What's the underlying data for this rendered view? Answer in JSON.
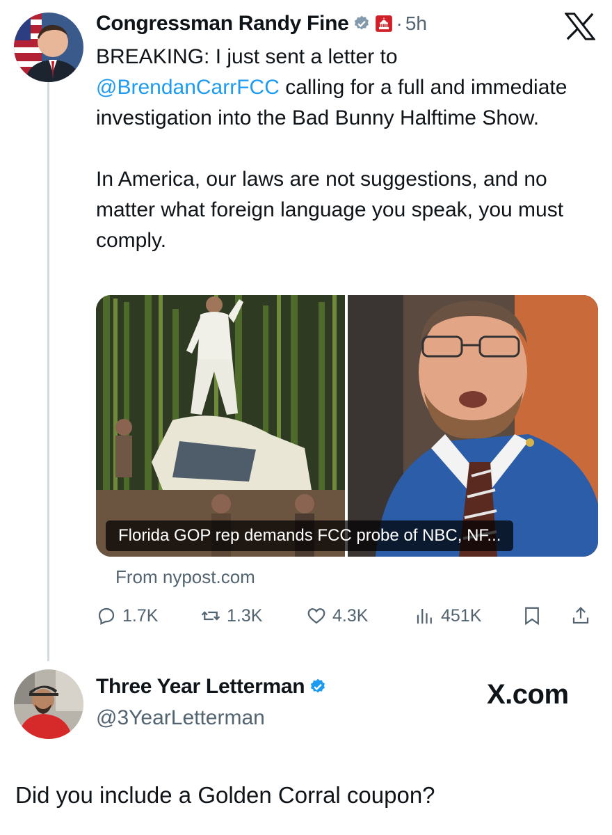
{
  "tweet": {
    "author": {
      "name": "Congressman Randy Fine",
      "time_ago": "5h",
      "verified": true,
      "badge_color": "#829aab",
      "affiliation_icon": "capitol-building-icon",
      "affiliation_color": "#d0202a"
    },
    "text_before_mention": "BREAKING: I just sent a letter to\n",
    "mention": "@BrendanCarrFCC",
    "text_after_mention": " calling for a full and immediate investigation into the Bad Bunny Halftime Show.\n\nIn America, our laws are not suggestions, and no matter what foreign language you speak, you must comply.",
    "link_card": {
      "caption": "Florida GOP rep demands FCC probe of NBC, NF...",
      "source": "From nypost.com"
    },
    "metrics": {
      "replies": "1.7K",
      "reposts": "1.3K",
      "likes": "4.3K",
      "views": "451K"
    }
  },
  "reply": {
    "name": "Three Year Letterman",
    "handle": "@3YearLetterman",
    "verified": true,
    "badge_color": "#1d9bf0",
    "watermark": "X.com",
    "text": "Did you include a Golden Corral coupon?"
  },
  "colors": {
    "mention": "#1d9bf0",
    "secondary_text": "#536471",
    "thread_line": "#cfd9de"
  }
}
